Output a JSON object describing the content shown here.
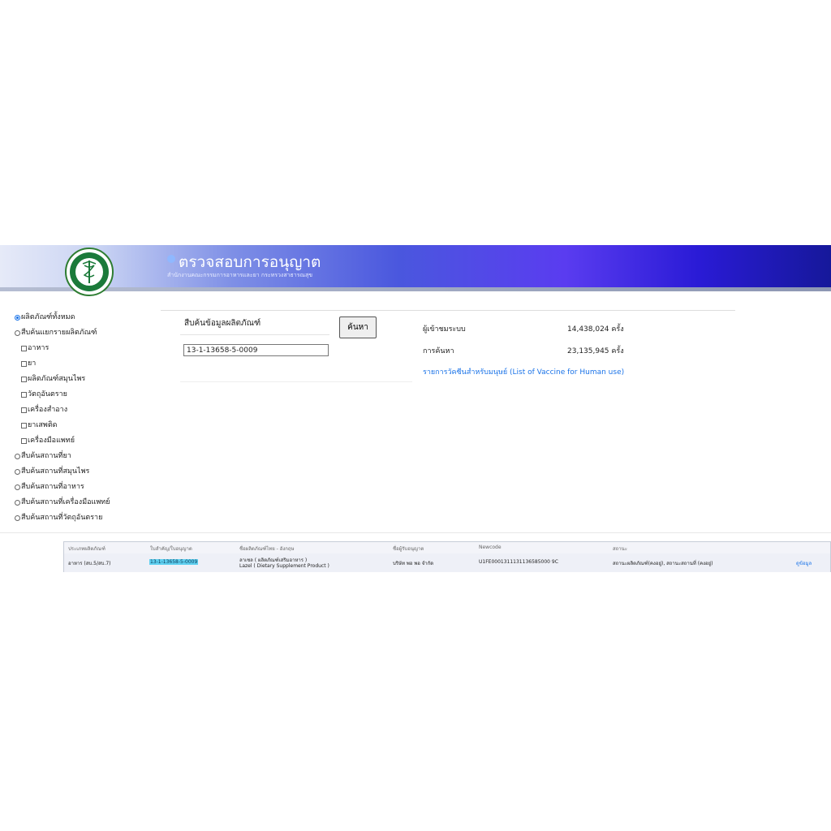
{
  "header": {
    "title": "ตรวจสอบการอนุญาต",
    "subtitle": "สำนักงานคณะกรรมการอาหารและยา กระทรวงสาธารณสุข",
    "logo_icon": "ministry-of-public-health-seal-icon"
  },
  "sidebar": {
    "items": [
      {
        "label": "ผลิตภัณฑ์ทั้งหมด",
        "type": "radio",
        "checked": true
      },
      {
        "label": "สืบค้นแยกรายผลิตภัณฑ์",
        "type": "radio",
        "checked": false
      },
      {
        "label": "อาหาร",
        "type": "checkbox",
        "checked": false
      },
      {
        "label": "ยา",
        "type": "checkbox",
        "checked": false
      },
      {
        "label": "ผลิตภัณฑ์สมุนไพร",
        "type": "checkbox",
        "checked": false
      },
      {
        "label": "วัตถุอันตราย",
        "type": "checkbox",
        "checked": false
      },
      {
        "label": "เครื่องสำอาง",
        "type": "checkbox",
        "checked": false
      },
      {
        "label": "ยาเสพติด",
        "type": "checkbox",
        "checked": false
      },
      {
        "label": "เครื่องมือแพทย์",
        "type": "checkbox",
        "checked": false
      },
      {
        "label": "สืบค้นสถานที่ยา",
        "type": "radio",
        "checked": false
      },
      {
        "label": "สืบค้นสถานที่สมุนไพร",
        "type": "radio",
        "checked": false
      },
      {
        "label": "สืบค้นสถานที่อาหาร",
        "type": "radio",
        "checked": false
      },
      {
        "label": "สืบค้นสถานที่เครื่องมือแพทย์",
        "type": "radio",
        "checked": false
      },
      {
        "label": "สืบค้นสถานที่วัตถุอันตราย",
        "type": "radio",
        "checked": false
      }
    ]
  },
  "search": {
    "title": "สืบค้นข้อมูลผลิตภัณฑ์",
    "value": "13-1-13658-5-0009",
    "button_label": "ค้นหา"
  },
  "stats": {
    "visitors_label": "ผู้เข้าชมระบบ",
    "visitors_value": "14,438,024 ครั้ง",
    "searches_label": "การค้นหา",
    "searches_value": "23,135,945 ครั้ง",
    "vaccine_link": "รายการวัคซีนสำหรับมนุษย์ (List of Vaccine for Human use)"
  },
  "results": {
    "headers": [
      "ประเภทผลิตภัณฑ์",
      "ใบสำคัญ/ใบอนุญาต",
      "ชื่อผลิตภัณฑ์ไทย - อังกฤษ",
      "ชื่อผู้รับอนุญาต",
      "Newcode",
      "สถานะ"
    ],
    "row": {
      "type": "อาหาร (สบ.5/สบ.7)",
      "license": "13-1-13658-5-0009",
      "name_th": "ลาเซล ( ผลิตภัณฑ์เสริมอาหาร )",
      "name_en": "Lazel ( Dietary Supplement Product )",
      "licensee": "บริษัท พอ พอ จำกัด",
      "newcode": "U1FE0001311131136585000 9C",
      "status": "สถานะผลิตภัณฑ์(คงอยู่), สถานะสถานที่ (คงอยู่)",
      "detail_link": "ดูข้อมูล"
    }
  }
}
